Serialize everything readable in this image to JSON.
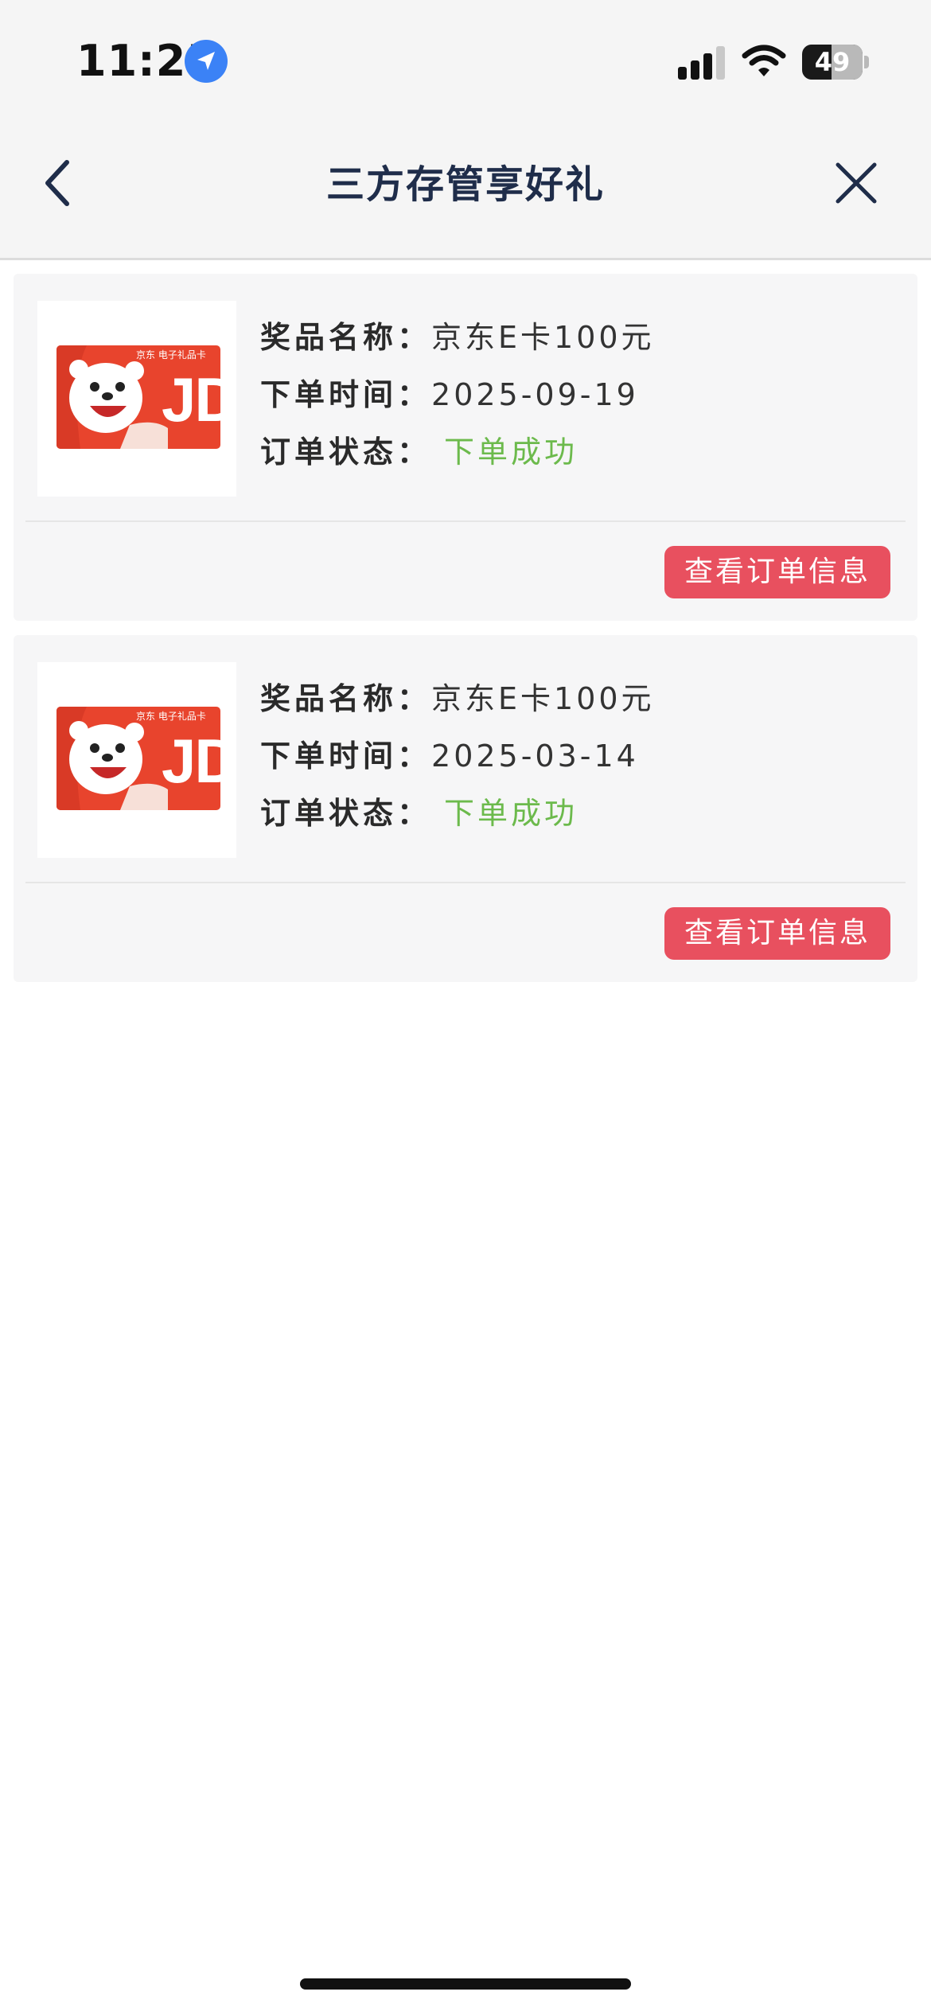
{
  "status_bar": {
    "time": "11:25",
    "battery_level": "49",
    "icons": [
      "location-arrow-icon",
      "cellular-signal-icon",
      "wifi-icon",
      "battery-icon"
    ]
  },
  "nav": {
    "title": "三方存管享好礼",
    "back_icon": "chevron-left-icon",
    "close_icon": "close-icon"
  },
  "labels": {
    "prize_name": "奖品名称：",
    "order_time": "下单时间：",
    "order_status": "订单状态："
  },
  "orders": [
    {
      "prize": "京东E卡100元",
      "date": "2025-09-19",
      "status": "下单成功",
      "button": "查看订单信息"
    },
    {
      "prize": "京东E卡100元",
      "date": "2025-03-14",
      "status": "下单成功",
      "button": "查看订单信息"
    }
  ],
  "card_image": {
    "logo": "JD",
    "brand_line": "京东 电子礼品卡"
  },
  "colors": {
    "title": "#1f2d4a",
    "success": "#6cba4c",
    "button": "#e8505f",
    "card_bg": "#f6f6f7",
    "jd_red": "#e8442d"
  }
}
